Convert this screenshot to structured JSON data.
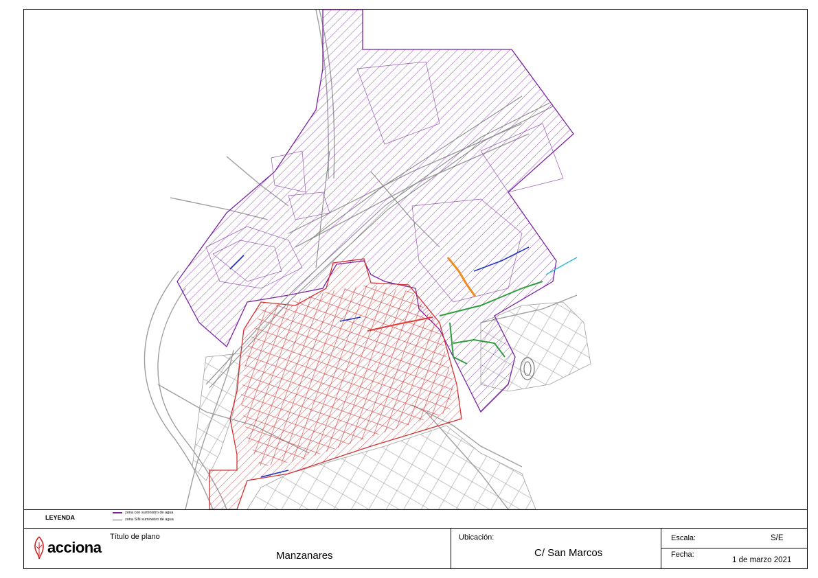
{
  "map": {
    "colors": {
      "supplied_zone": "#7b1fa2",
      "no_supply_zone": "#d32f2f",
      "streets": "#9e9e9e",
      "green_network": "#2e9e3a",
      "blue_network": "#1a33c8",
      "orange_works": "#f08a1c",
      "cyan_pipe": "#31b8d6"
    }
  },
  "legend": {
    "title": "LEYENDA",
    "items": [
      {
        "label": "zona con suministro de agua",
        "color": "#7b1fa2"
      },
      {
        "label": "zona SIN suministro de agua",
        "color": "#d32f2f"
      }
    ]
  },
  "titleblock": {
    "logo_text": "acciona",
    "logo_icon": "acciona-leaf-logo",
    "plan_title_label": "Título de plano",
    "plan_title_value": "Manzanares",
    "location_label": "Ubicación:",
    "location_value": "C/ San Marcos",
    "scale_label": "Escala:",
    "scale_value": "S/E",
    "date_label": "Fecha:",
    "date_value": "1 de marzo 2021"
  }
}
